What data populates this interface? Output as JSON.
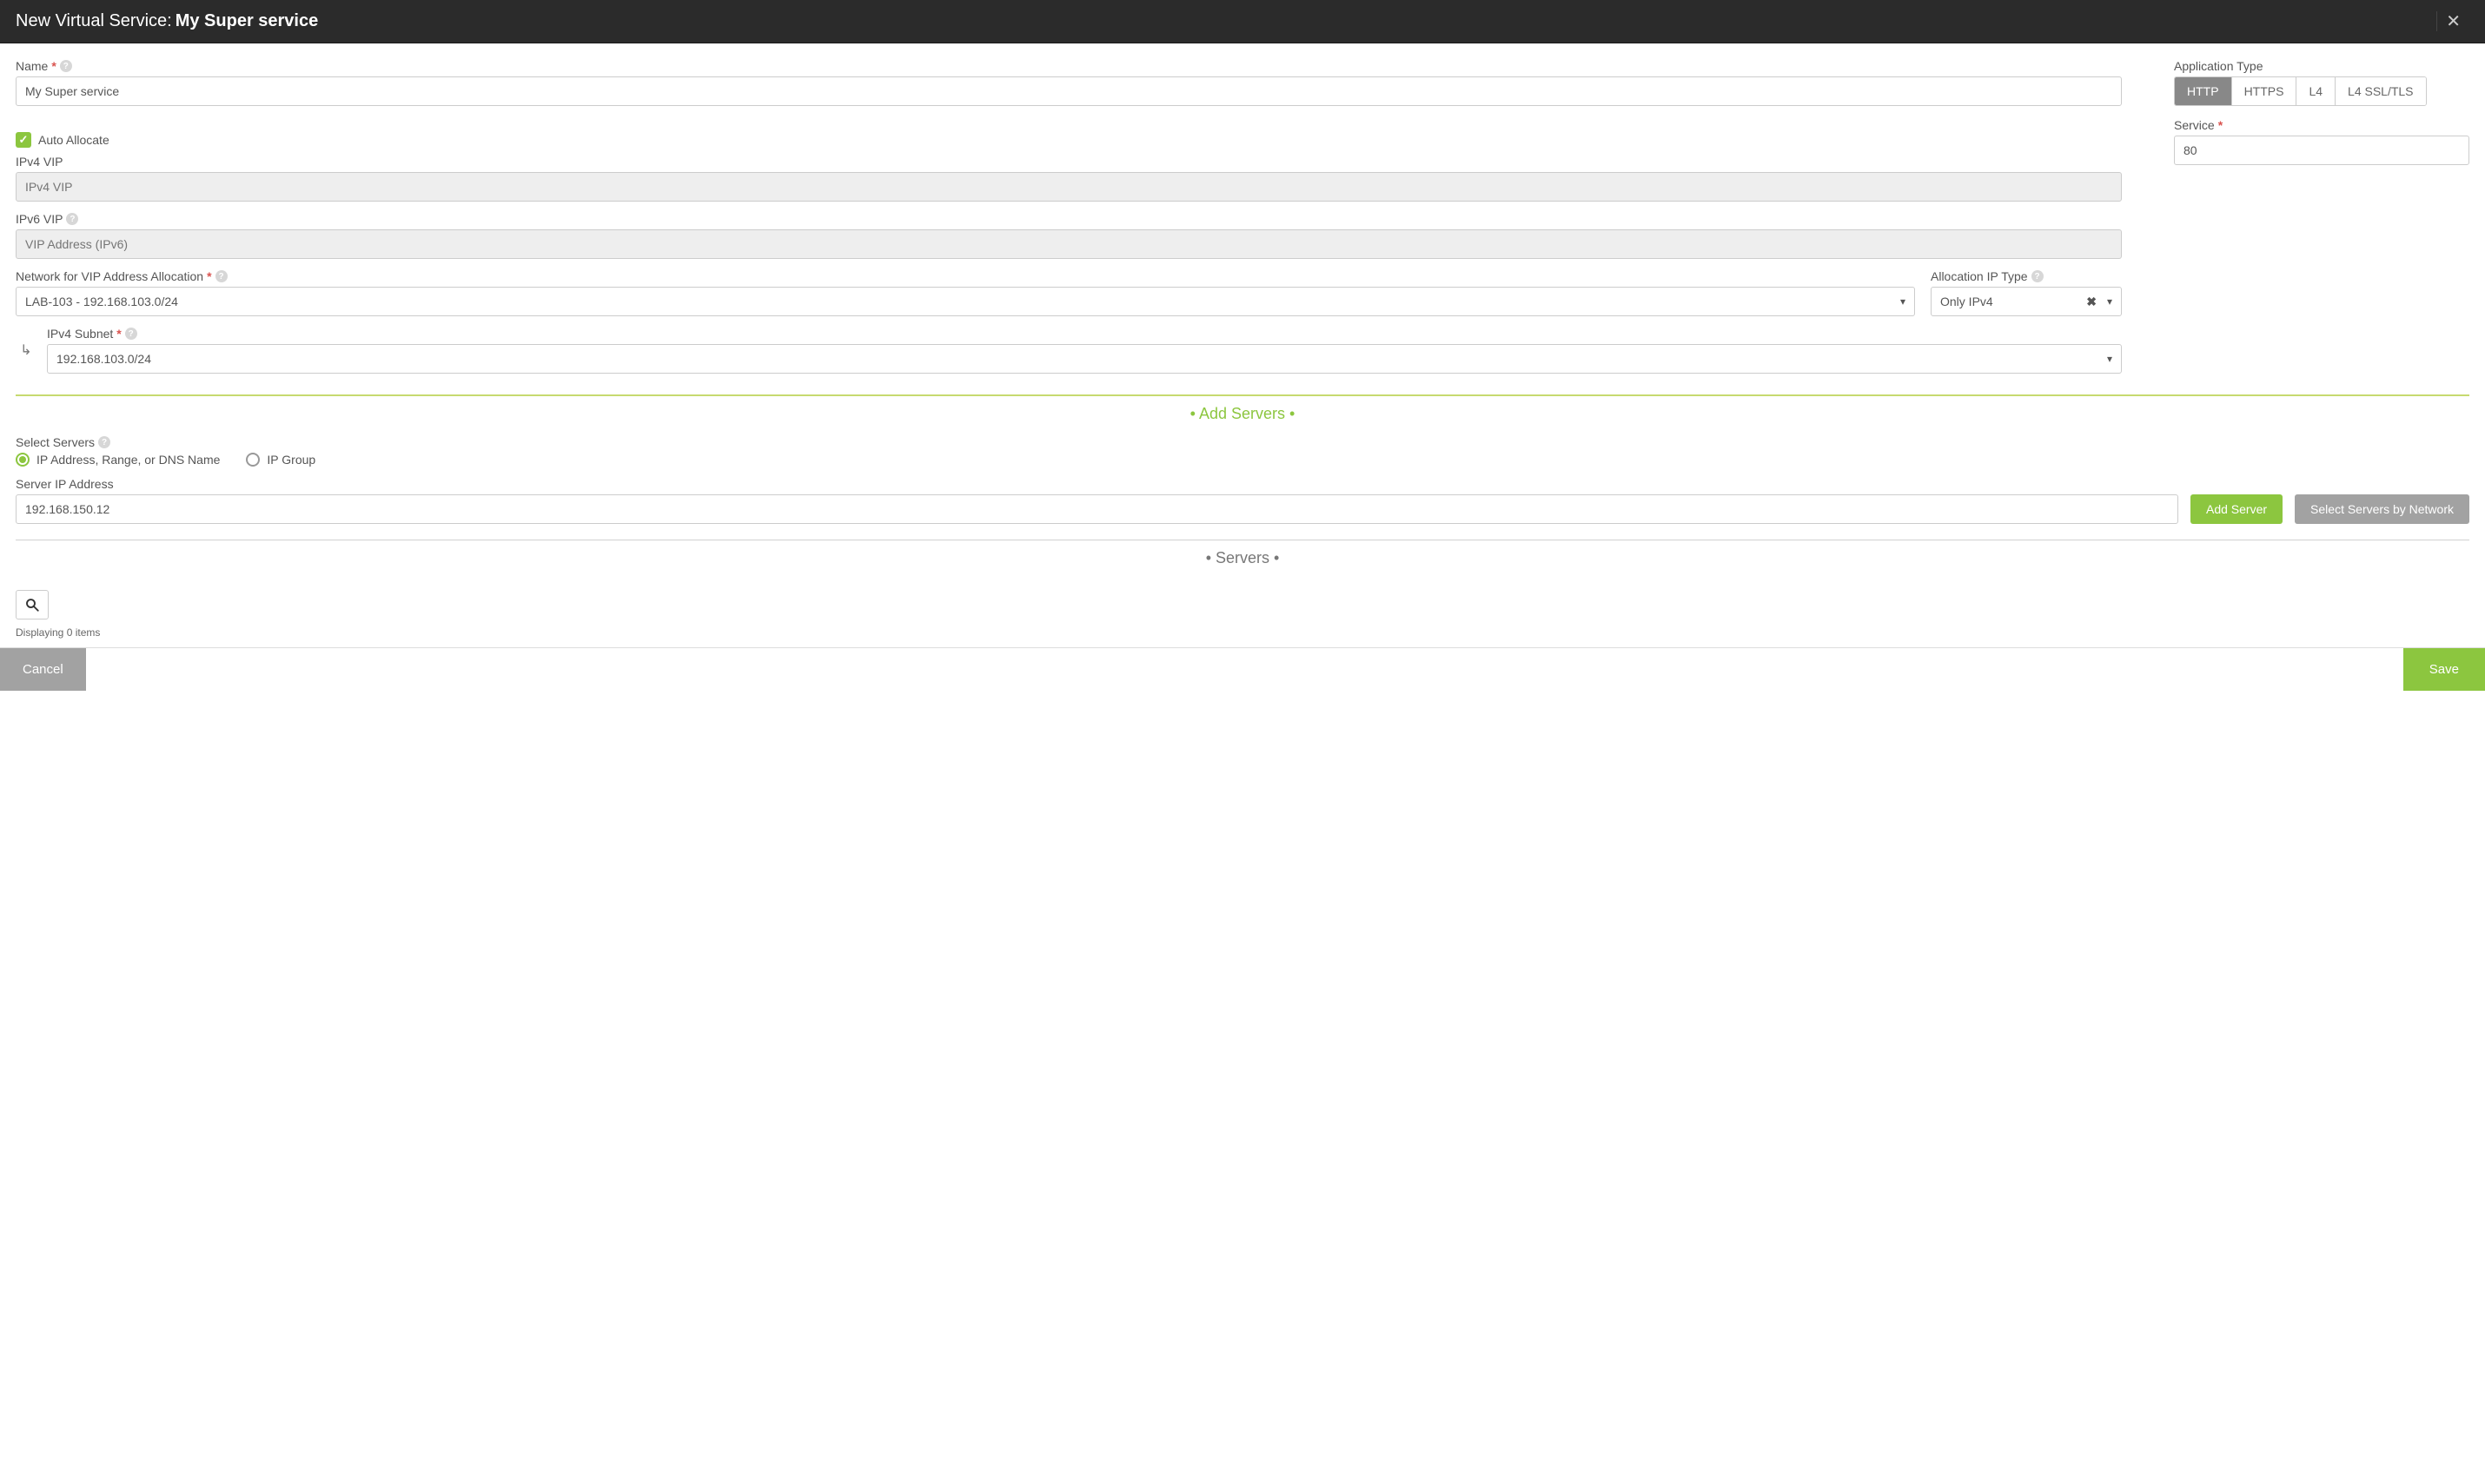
{
  "header": {
    "prefix": "New Virtual Service:",
    "name": "My Super service"
  },
  "name": {
    "label": "Name",
    "value": "My Super service"
  },
  "application_type": {
    "label": "Application Type",
    "options": [
      "HTTP",
      "HTTPS",
      "L4",
      "L4 SSL/TLS"
    ],
    "selected": "HTTP"
  },
  "service": {
    "label": "Service",
    "value": "80"
  },
  "auto_allocate": {
    "label": "Auto Allocate",
    "checked": true
  },
  "ipv4_vip": {
    "label": "IPv4 VIP",
    "placeholder": "IPv4 VIP",
    "value": ""
  },
  "ipv6_vip": {
    "label": "IPv6 VIP",
    "placeholder": "VIP Address (IPv6)",
    "value": ""
  },
  "network_alloc": {
    "label": "Network for VIP Address Allocation",
    "value": "LAB-103 - 192.168.103.0/24"
  },
  "alloc_ip_type": {
    "label": "Allocation IP Type",
    "value": "Only IPv4"
  },
  "ipv4_subnet": {
    "label": "IPv4 Subnet",
    "value": "192.168.103.0/24"
  },
  "add_servers_section": "•  Add Servers  •",
  "select_servers": {
    "label": "Select Servers",
    "opt_ip": "IP Address, Range, or DNS Name",
    "opt_group": "IP Group",
    "selected": "ip"
  },
  "server_ip": {
    "label": "Server IP Address",
    "value": "192.168.150.12"
  },
  "buttons": {
    "add_server": "Add Server",
    "select_by_net": "Select Servers by Network"
  },
  "servers_section": "•  Servers  •",
  "items_text": "Displaying 0 items",
  "footer": {
    "cancel": "Cancel",
    "save": "Save"
  }
}
